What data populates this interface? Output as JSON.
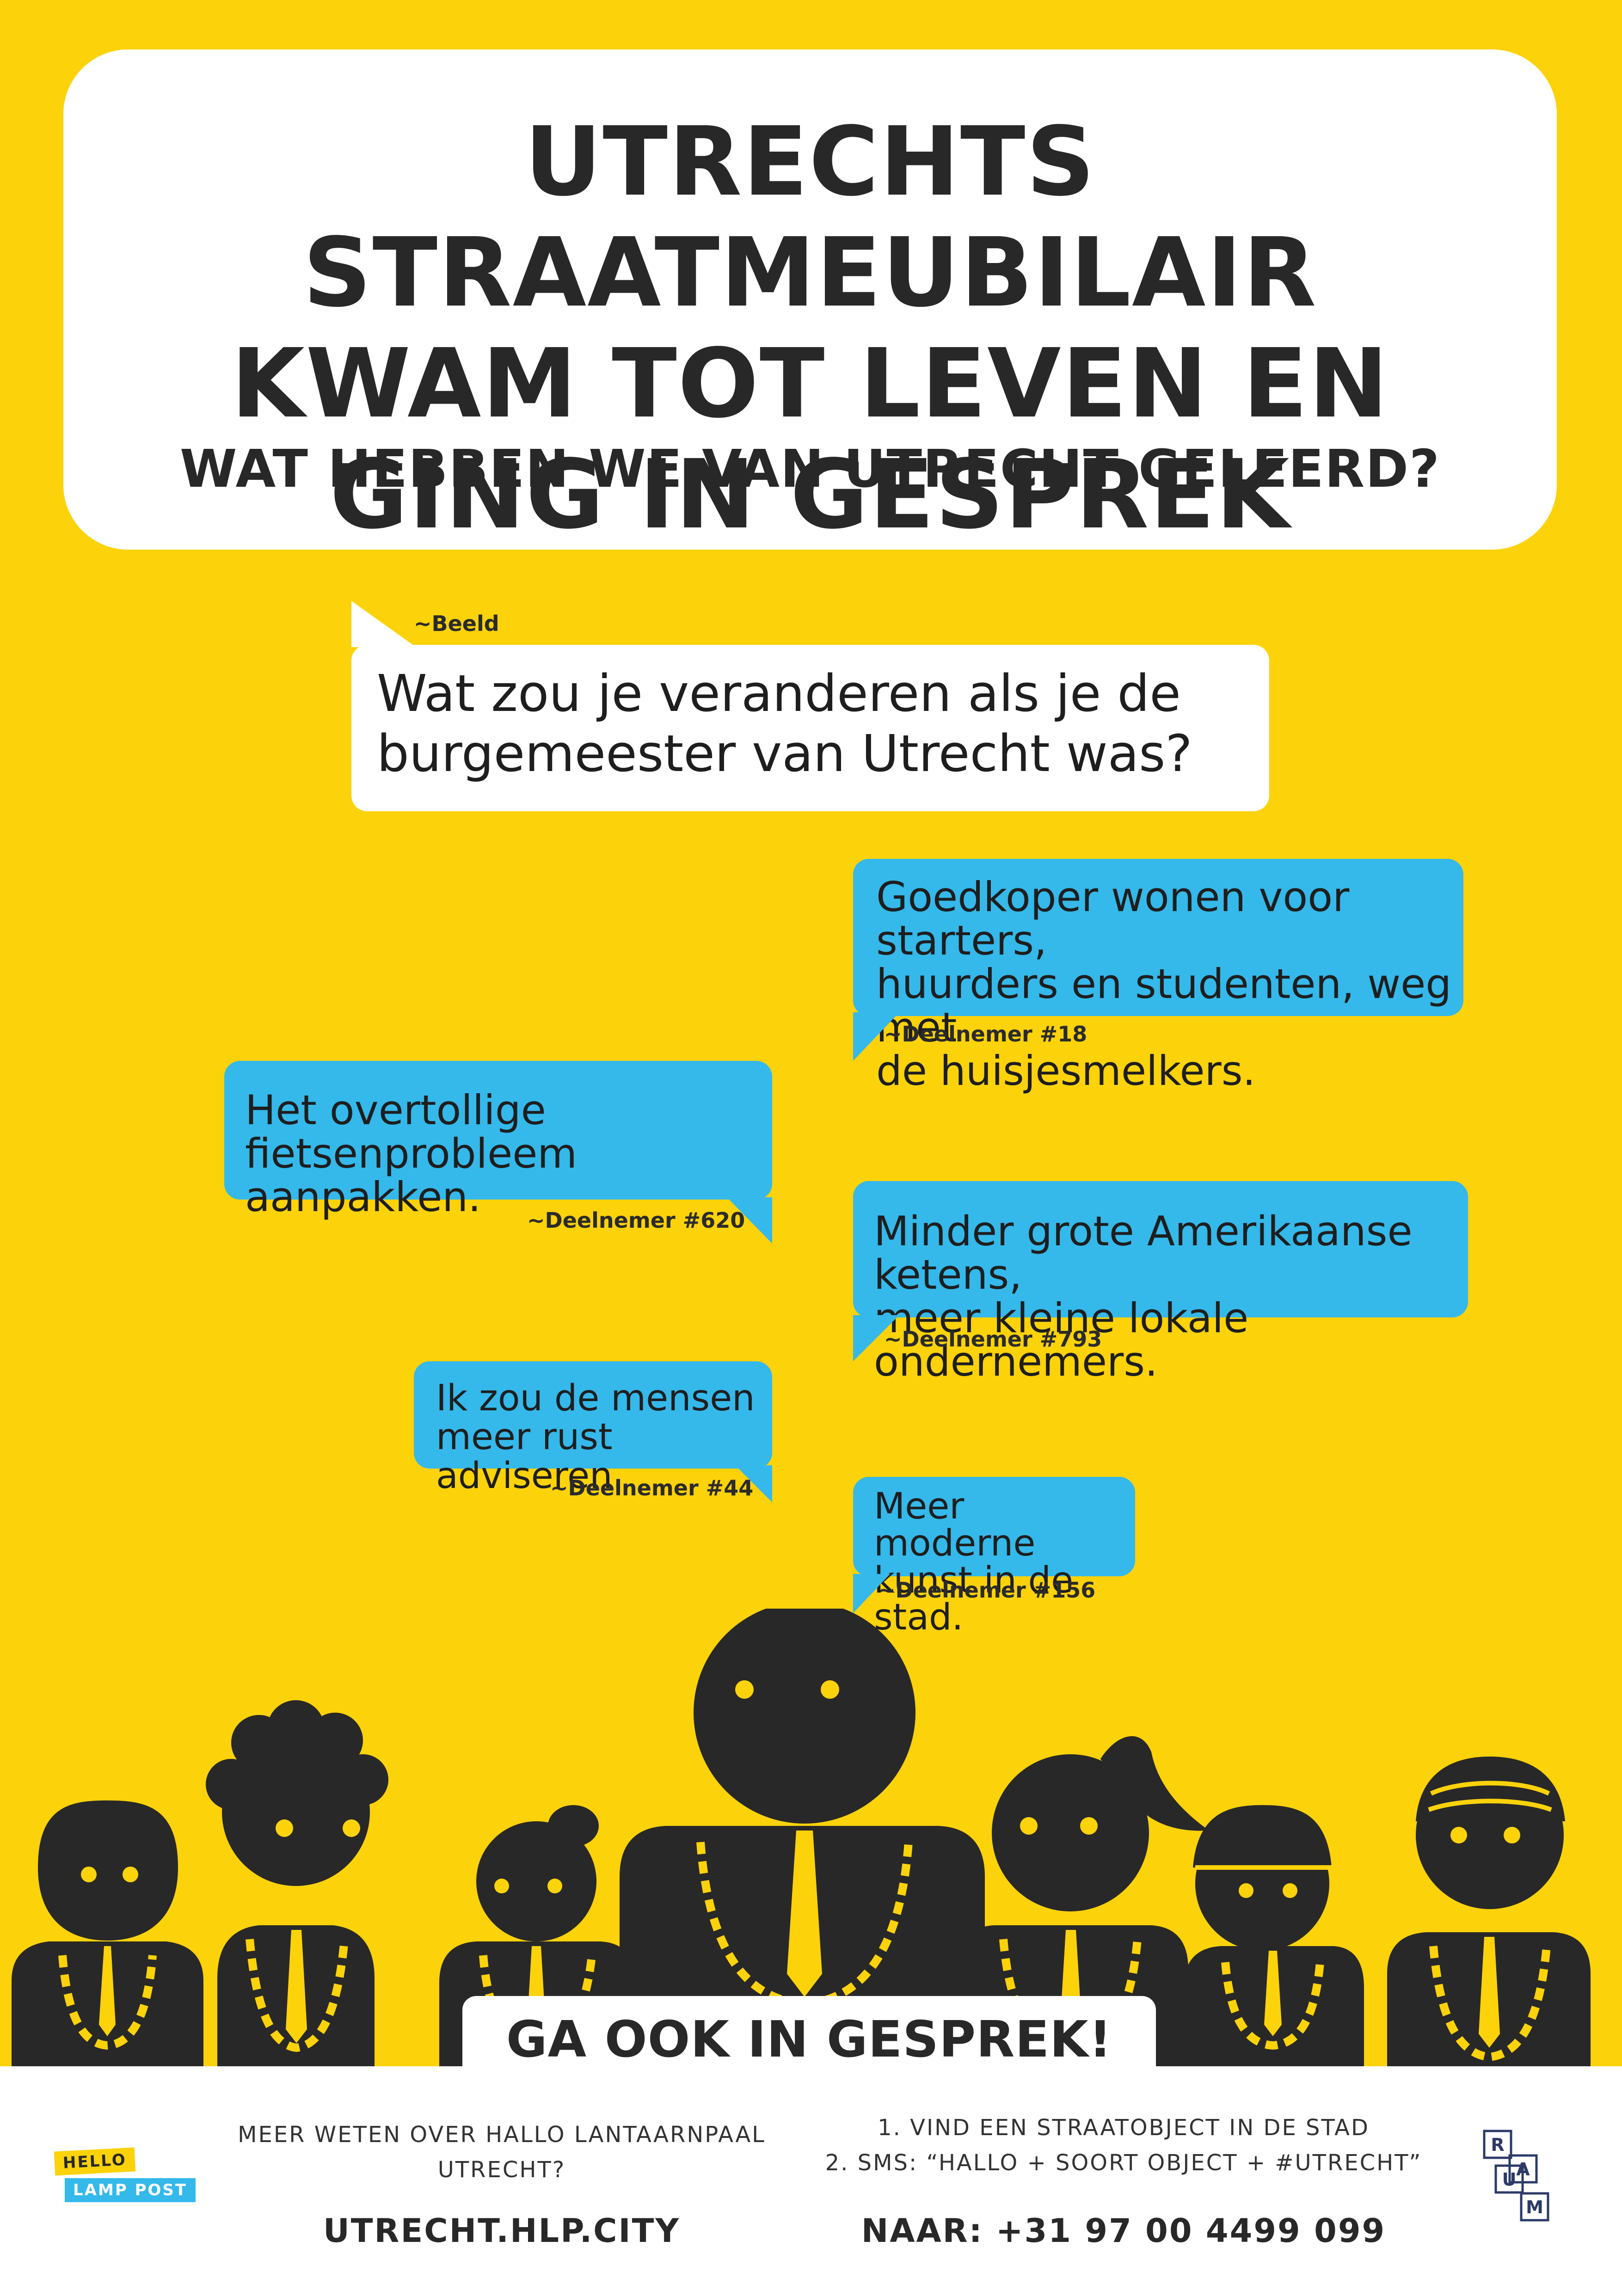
{
  "title_lines": [
    "UTRECHTS STRAATMEUBILAIR",
    "KWAM TOT LEVEN EN",
    "GING IN GESPREK"
  ],
  "subtitle": "WAT HEBBEN WE VAN UTRECHT GELEERD?",
  "question": {
    "author": "~Beeld",
    "text_lines": [
      "Wat zou je veranderen als je de",
      "burgemeester van Utrecht was?"
    ]
  },
  "answers": [
    {
      "lines": [
        "Goedkoper wonen voor starters,",
        "huurders en studenten, weg met",
        "de huisjesmelkers."
      ],
      "sig": "~Deelnemer #18"
    },
    {
      "lines": [
        "Het overtollige",
        "fietsenprobleem aanpakken."
      ],
      "sig": "~Deelnemer #620"
    },
    {
      "lines": [
        "Minder grote Amerikaanse ketens,",
        "meer kleine lokale ondernemers."
      ],
      "sig": "~Deelnemer #793"
    },
    {
      "lines": [
        "Ik zou de mensen",
        "meer rust adviseren."
      ],
      "sig": "~Deelnemer #44"
    },
    {
      "lines": [
        "Meer moderne",
        "kunst in de stad."
      ],
      "sig": "~Deelnemer #156"
    }
  ],
  "cta": "GA OOK IN GESPREK!",
  "footer": {
    "info_lines": [
      "MEER WETEN OVER HALLO LANTAARNPAAL",
      "UTRECHT?"
    ],
    "website": "UTRECHT.HLP.CITY",
    "steps": [
      "1. VIND EEN STRAATOBJECT IN DE STAD",
      "2. SMS: “HALLO + SOORT OBJECT + #UTRECHT”"
    ],
    "phone": "NAAR: +31 97 00 4499 099",
    "logo_hello": "HELLO",
    "logo_lamppost": "LAMP POST",
    "raum_letters": [
      "R",
      "A",
      "U",
      "M"
    ]
  },
  "colors": {
    "background": "#FCD20A",
    "blue": "#35B8EA",
    "dark": "#282828",
    "white": "#FFFFFF"
  }
}
